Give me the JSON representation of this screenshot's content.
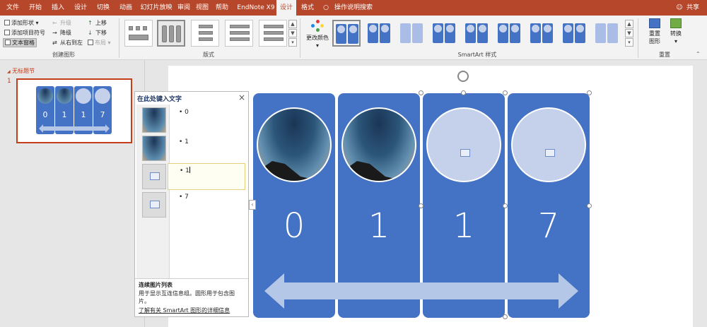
{
  "menu": {
    "tabs": [
      "文件",
      "开始",
      "插入",
      "设计",
      "切换",
      "动画",
      "幻灯片放映",
      "审阅",
      "视图",
      "帮助",
      "EndNote X9",
      "设计",
      "格式"
    ],
    "search_label": "操作说明搜索",
    "share_label": "共享"
  },
  "ribbon": {
    "create_graphic": {
      "add_shape": "添加形状",
      "add_bullet": "添加项目符号",
      "text_pane": "文本窗格",
      "promote": "升级",
      "demote": "降级",
      "right_to_left": "从右到左",
      "move_up": "上移",
      "move_down": "下移",
      "layout": "布局",
      "group_label": "创建图形"
    },
    "layouts_group_label": "版式",
    "change_colors": "更改颜色",
    "styles_group_label": "SmartArt 样式",
    "reset": {
      "reset_graphic": "重置图形",
      "convert": "转换",
      "group_label": "重置"
    }
  },
  "left_pane": {
    "section_title": "无标题节",
    "slide_number": "1",
    "thumb_values": [
      "0",
      "1",
      "1",
      "7"
    ]
  },
  "text_pane": {
    "title": "在此处键入文字",
    "close": "×",
    "items": [
      "0",
      "1",
      "1",
      "7"
    ],
    "footer_title": "连续图片列表",
    "footer_desc": "用于显示互连信息组。圆形用于包含图片。",
    "footer_link": "了解有关 SmartArt 图形的详细信息"
  },
  "smartart": {
    "columns": [
      "0",
      "1",
      "1",
      "7"
    ],
    "accent_color": "#4472c4"
  }
}
